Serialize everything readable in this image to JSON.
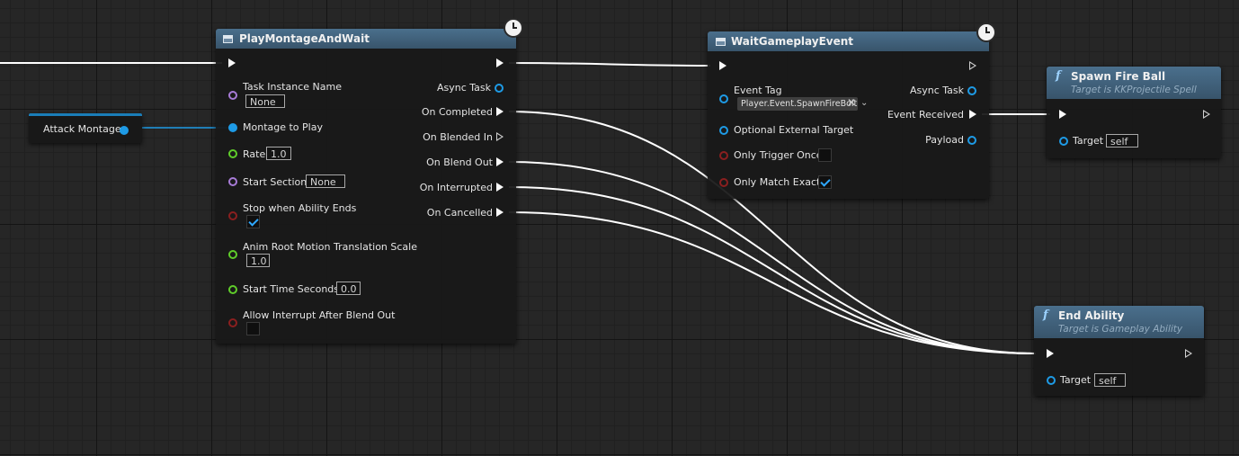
{
  "colors": {
    "exec_wire": "#ffffff",
    "object_pin": "#1e9be6",
    "class_pin": "#a77bd6",
    "bool_pin": "#8a1f1f",
    "float_pin": "#5fcc2a",
    "header": "#4a6f8c"
  },
  "icons": [
    "node-icon",
    "latent-clock-icon",
    "function-icon",
    "exec-pin-icon",
    "data-pin-icon",
    "checkmark-icon",
    "clear-x-icon",
    "chevron-down-icon"
  ],
  "var_node": {
    "label": "Attack Montage"
  },
  "play_montage": {
    "title": "PlayMontageAndWait",
    "inputs": {
      "task_instance_name": "Task Instance Name",
      "task_instance_value": "None",
      "montage_to_play": "Montage to Play",
      "rate": "Rate",
      "rate_value": "1.0",
      "start_section": "Start Section",
      "start_section_value": "None",
      "stop_when_ability_ends": "Stop when Ability Ends",
      "stop_when_ability_ends_checked": true,
      "anim_root_motion": "Anim Root Motion Translation Scale",
      "anim_root_motion_value": "1.0",
      "start_time_seconds": "Start Time Seconds",
      "start_time_seconds_value": "0.0",
      "allow_interrupt": "Allow Interrupt After Blend Out",
      "allow_interrupt_checked": false
    },
    "outputs": {
      "async_task": "Async Task",
      "on_completed": "On Completed",
      "on_blended_in": "On Blended In",
      "on_blend_out": "On Blend Out",
      "on_interrupted": "On Interrupted",
      "on_cancelled": "On Cancelled"
    }
  },
  "wait_event": {
    "title": "WaitGameplayEvent",
    "inputs": {
      "event_tag": "Event Tag",
      "event_tag_value": "Player.Event.SpawnFireBolt",
      "optional_external_target": "Optional External Target",
      "only_trigger_once": "Only Trigger Once",
      "only_trigger_once_checked": false,
      "only_match_exact": "Only Match Exact",
      "only_match_exact_checked": true
    },
    "outputs": {
      "async_task": "Async Task",
      "event_received": "Event Received",
      "payload": "Payload"
    }
  },
  "spawn_fire_ball": {
    "title": "Spawn Fire Ball",
    "subtitle": "Target is KKProjectile Spell",
    "target_label": "Target",
    "target_value": "self"
  },
  "end_ability": {
    "title": "End Ability",
    "subtitle": "Target is Gameplay Ability",
    "target_label": "Target",
    "target_value": "self"
  }
}
